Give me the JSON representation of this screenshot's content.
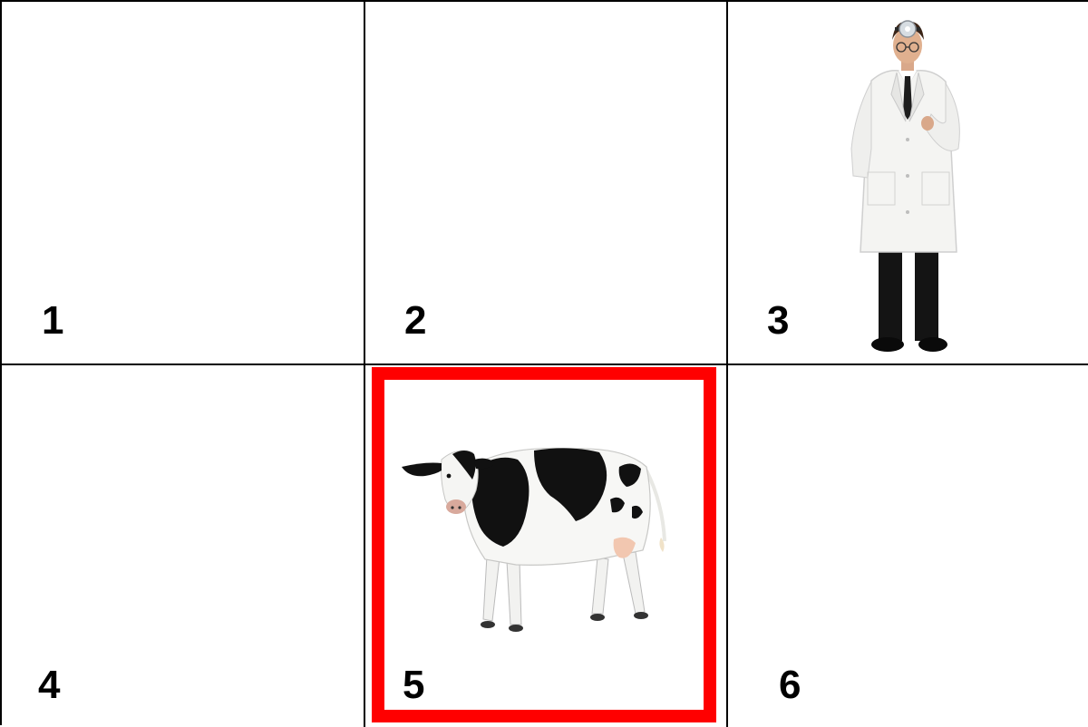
{
  "grid": {
    "cells": [
      {
        "number": "1",
        "content": "empty"
      },
      {
        "number": "2",
        "content": "empty"
      },
      {
        "number": "3",
        "content": "doctor-icon"
      },
      {
        "number": "4",
        "content": "empty"
      },
      {
        "number": "5",
        "content": "cow-icon"
      },
      {
        "number": "6",
        "content": "empty"
      }
    ],
    "selected_cell": "5",
    "colors": {
      "selection": "#ff0000",
      "lines": "#000000",
      "background": "#ffffff"
    }
  }
}
